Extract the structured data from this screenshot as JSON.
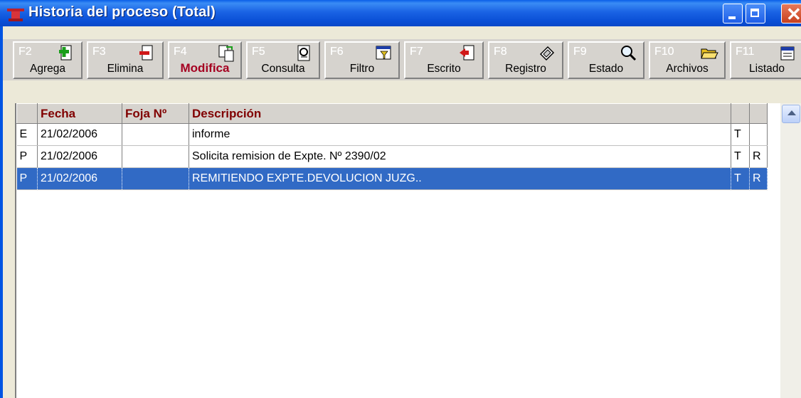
{
  "window": {
    "title": "Historia del proceso (Total)",
    "accent": "#0054e3",
    "selection_color": "#316ac5",
    "header_text_color": "#800000"
  },
  "toolbar": {
    "buttons": [
      {
        "key": "F2",
        "label": "Agrega",
        "icon": "add-document-icon"
      },
      {
        "key": "F3",
        "label": "Elimina",
        "icon": "remove-document-icon"
      },
      {
        "key": "F4",
        "label": "Modifica",
        "icon": "edit-document-icon"
      },
      {
        "key": "F5",
        "label": "Consulta",
        "icon": "view-document-icon"
      },
      {
        "key": "F6",
        "label": "Filtro",
        "icon": "filter-icon"
      },
      {
        "key": "F7",
        "label": "Escrito",
        "icon": "write-document-icon"
      },
      {
        "key": "F8",
        "label": "Registro",
        "icon": "register-icon"
      },
      {
        "key": "F9",
        "label": "Estado",
        "icon": "magnifier-icon"
      },
      {
        "key": "F10",
        "label": "Archivos",
        "icon": "folder-icon"
      },
      {
        "key": "F11",
        "label": "Listado",
        "icon": "list-icon"
      }
    ]
  },
  "grid": {
    "columns": [
      "",
      "Fecha",
      "Foja Nº",
      "Descripción",
      "",
      ""
    ],
    "rows": [
      {
        "type": "E",
        "fecha": "21/02/2006",
        "foja": "",
        "descripcion": "informe",
        "c5": "T",
        "c6": ""
      },
      {
        "type": "P",
        "fecha": "21/02/2006",
        "foja": "",
        "descripcion": "Solicita remision de Expte. Nº 2390/02",
        "c5": "T",
        "c6": "R"
      },
      {
        "type": "P",
        "fecha": "21/02/2006",
        "foja": "",
        "descripcion": "REMITIENDO EXPTE.DEVOLUCION JUZG..",
        "c5": "T",
        "c6": "R"
      }
    ],
    "selected_row": 2
  }
}
